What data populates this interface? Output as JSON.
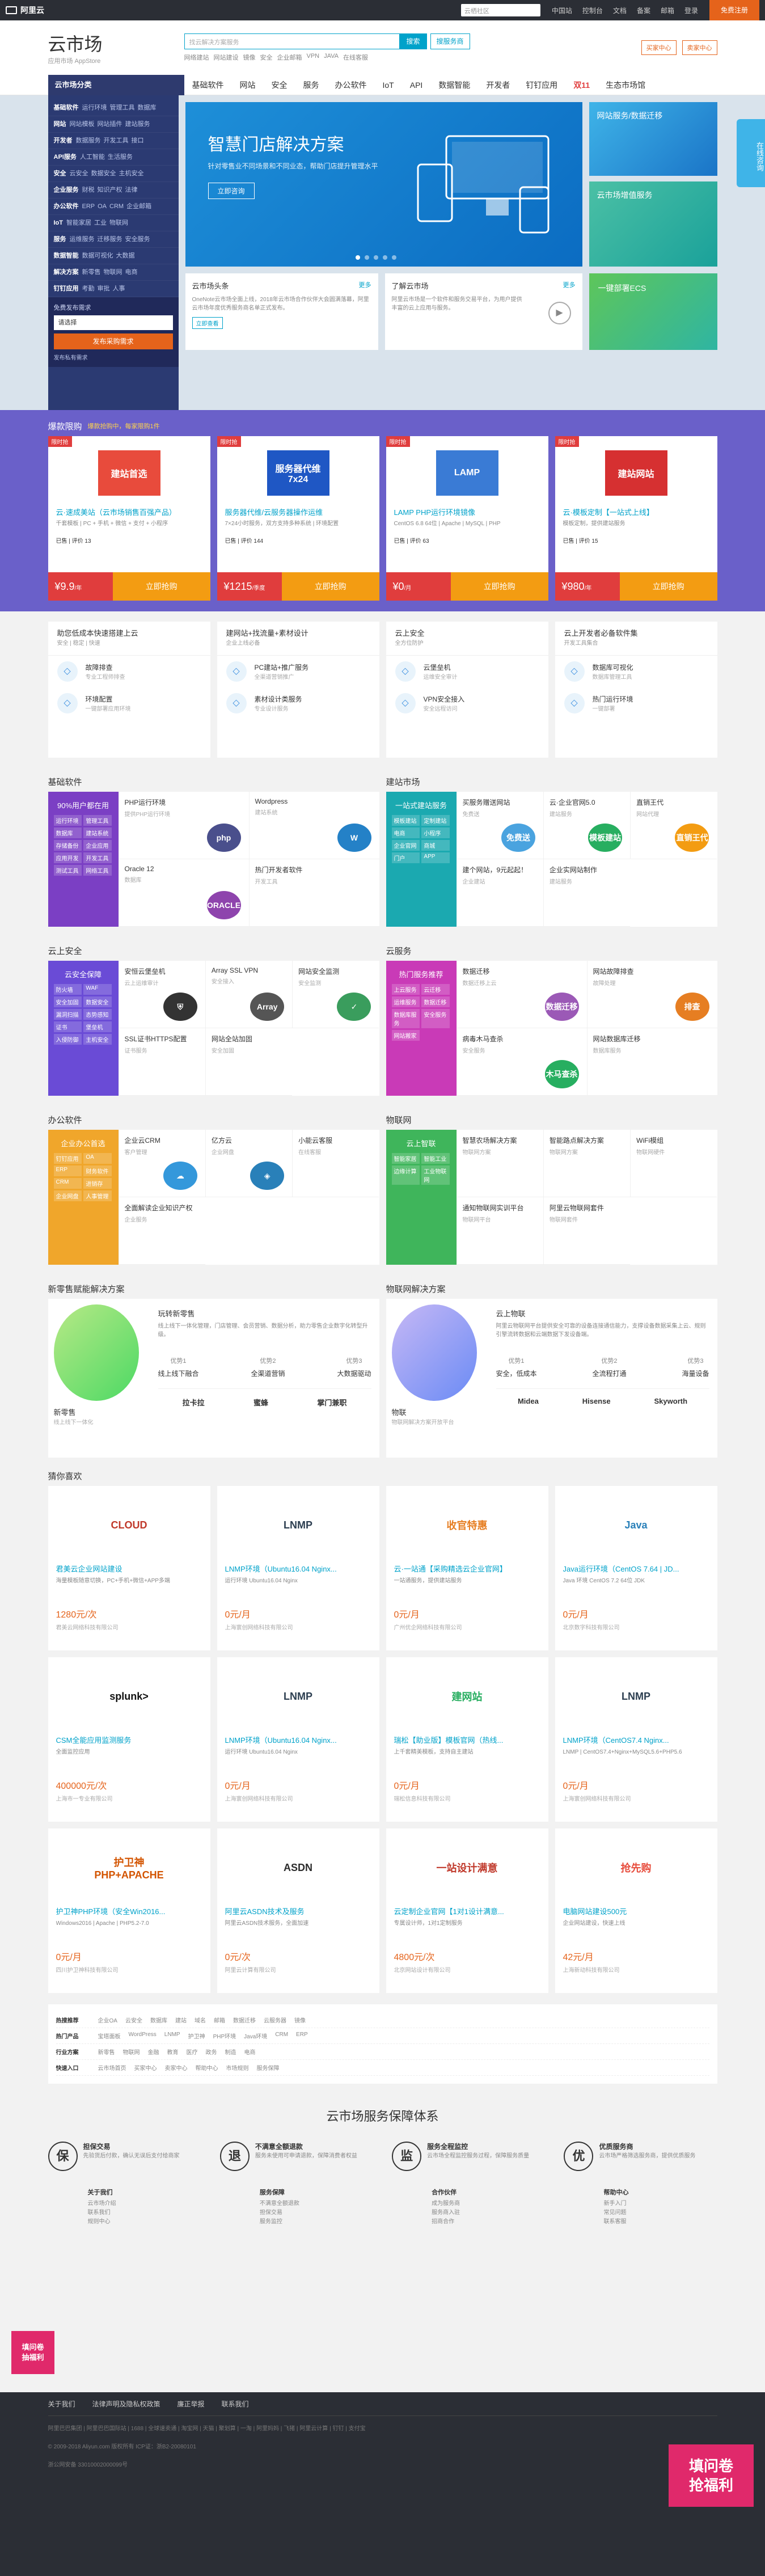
{
  "topbar": {
    "logo": "阿里云",
    "search_placeholder": "云栖社区",
    "links": [
      "中国站",
      "控制台",
      "文档",
      "备案",
      "邮箱",
      "登录"
    ],
    "free_register": "免费注册"
  },
  "header": {
    "title": "云市场",
    "subtitle": "应用市场 AppStore",
    "search_placeholder": "找云解决方案服务",
    "search_btn": "搜索",
    "search_btn2": "搜服务商",
    "hot": [
      "网络建站",
      "网站建设",
      "镜像",
      "安全",
      "企业邮箱",
      "VPN",
      "JAVA",
      "在线客服"
    ],
    "right": [
      "买家中心",
      "卖家中心"
    ]
  },
  "nav": {
    "catalog": "云市场分类",
    "items": [
      "基础软件",
      "网站",
      "安全",
      "服务",
      "办公软件",
      "IoT",
      "API",
      "数据智能",
      "开发者",
      "钉钉应用",
      "双11"
    ],
    "last": "生态市场馆"
  },
  "sidecat": [
    {
      "main": "基础软件",
      "subs": [
        "运行环境",
        "管理工具",
        "数据库"
      ]
    },
    {
      "main": "网站",
      "subs": [
        "网站模板",
        "网站插件",
        "建站服务"
      ]
    },
    {
      "main": "开发者",
      "subs": [
        "数据服务",
        "开发工具",
        "接口"
      ]
    },
    {
      "main": "API服务",
      "subs": [
        "人工智能",
        "生活服务"
      ]
    },
    {
      "main": "安全",
      "subs": [
        "云安全",
        "数据安全",
        "主机安全"
      ]
    },
    {
      "main": "企业服务",
      "subs": [
        "财税",
        "知识产权",
        "法律"
      ]
    },
    {
      "main": "办公软件",
      "subs": [
        "ERP",
        "OA",
        "CRM",
        "企业邮箱"
      ]
    },
    {
      "main": "IoT",
      "subs": [
        "智能家居",
        "工业",
        "物联网"
      ]
    },
    {
      "main": "服务",
      "subs": [
        "运维服务",
        "迁移服务",
        "安全服务"
      ]
    },
    {
      "main": "数据智能",
      "subs": [
        "数据可视化",
        "大数据"
      ]
    },
    {
      "main": "解决方案",
      "subs": [
        "新零售",
        "物联网",
        "电商"
      ]
    },
    {
      "main": "钉钉应用",
      "subs": [
        "考勤",
        "审批",
        "人事"
      ]
    }
  ],
  "login": {
    "title": "免费发布需求",
    "select": "请选择",
    "button": "发布采购需求",
    "mail": "发布私有需求"
  },
  "slide": {
    "title": "智慧门店解决方案",
    "desc": "针对零售业不同场景和不同业态，帮助门店提升管理水平",
    "btn": "立即咨询"
  },
  "side_ads": [
    "网站服务/数据迁移",
    "云市场增值服务",
    "一键部署ECS"
  ],
  "news": {
    "title": "云市场头条",
    "more": "更多",
    "desc": "OneNote云市场全面上线，2018年云市场合作伙伴大会圆满落幕，阿里云市场年度优秀服务商名单正式发布。",
    "btn": "立即查看"
  },
  "about": {
    "title": "了解云市场",
    "desc": "阿里云市场是一个软件和服务交易平台，为用户提供丰富的云上应用与服务。",
    "more": "更多"
  },
  "flash": {
    "title": "爆款限购",
    "sub": "爆款抢购中，每家限购1件"
  },
  "deals": [
    {
      "tag": "限时抢",
      "img": "建站首选",
      "title": "云·速成美站（云市场销售百强产品）",
      "desc": "千套模板 | PC + 手机 + 微信 + 支付 + 小程序",
      "extra": "已售 | 评价 13",
      "price": "9.9",
      "unit": "/年",
      "buy": "立即抢购",
      "color": "#e84b3c"
    },
    {
      "tag": "限时抢",
      "img": "服务器代维7x24",
      "title": "服务器代维/云服务器操作运维",
      "desc": "7×24小时服务，双方支持多种系统 | 环境配置",
      "extra": "已售 | 评价 144",
      "price": "1215",
      "unit": "/季度",
      "buy": "立即抢购",
      "color": "#1f57c4"
    },
    {
      "tag": "限时抢",
      "img": "LAMP",
      "title": "LAMP PHP运行环境镜像",
      "desc": "CentOS 6.8 64位 | Apache | MySQL | PHP",
      "extra": "已售 | 评价 63",
      "price": "0",
      "unit": "/月",
      "buy": "立即抢购",
      "color": "#3a7bd5"
    },
    {
      "tag": "限时抢",
      "img": "建站网站",
      "title": "云·模板定制【一站式上线】",
      "desc": "模板定制，提供建站服务",
      "extra": "已售 | 评价 15",
      "price": "980",
      "unit": "/年",
      "buy": "立即抢购",
      "color": "#d63031"
    }
  ],
  "solutions": [
    {
      "title": "助您低成本快速搭建上云",
      "sub": "安全 | 稳定 | 快速",
      "items": [
        {
          "t": "故障排查",
          "s": "专业工程师排查"
        },
        {
          "t": "环境配置",
          "s": "一键部署应用环境"
        }
      ]
    },
    {
      "title": "建网站+找流量+素材设计",
      "sub": "企业上线必备",
      "items": [
        {
          "t": "PC建站+推广服务",
          "s": "全渠道营销推广"
        },
        {
          "t": "素材设计类服务",
          "s": "专业设计服务"
        }
      ]
    },
    {
      "title": "云上安全",
      "sub": "全方位防护",
      "items": [
        {
          "t": "云堡垒机",
          "s": "运维安全审计"
        },
        {
          "t": "VPN安全接入",
          "s": "安全远程访问"
        }
      ]
    },
    {
      "title": "云上开发者必备软件集",
      "sub": "开发工具集合",
      "items": [
        {
          "t": "数据库可视化",
          "s": "数据库管理工具"
        },
        {
          "t": "热门运行环境",
          "s": "一键部署"
        }
      ]
    }
  ],
  "basic_sw": {
    "title": "基础软件",
    "left_title": "90%用户都在用",
    "tags": [
      "运行环境",
      "管理工具",
      "数据库",
      "建站系统",
      "存储备份",
      "企业应用",
      "应用开发",
      "开发工具",
      "测试工具",
      "网络工具"
    ],
    "cells": [
      {
        "t": "PHP运行环境",
        "s": "提供PHP运行环境",
        "logo": "php",
        "bg": "#4a4f8c"
      },
      {
        "t": "Wordpress",
        "s": "建站系统",
        "logo": "W",
        "bg": "#2481c7"
      },
      {
        "t": "Oracle 12",
        "s": "数据库",
        "logo": "ORACLE",
        "bg": "#8e44ad"
      },
      {
        "t": "热门开发者软件",
        "s": "开发工具",
        "logo": "",
        "bg": "#fff"
      }
    ]
  },
  "website": {
    "title": "建站市场",
    "left_title": "一站式建站服务",
    "tags": [
      "模板建站",
      "定制建站",
      "电商",
      "小程序",
      "企业官网",
      "商城",
      "门户",
      "APP"
    ],
    "cells": [
      {
        "t": "买服务赠送网站",
        "s": "免费送",
        "logo": "免费送",
        "bg": "#4aa3df"
      },
      {
        "t": "云·企业官网5.0",
        "s": "建站服务",
        "logo": "模板建站",
        "bg": "#27ae60"
      },
      {
        "t": "直销王代",
        "s": "网站代理",
        "logo": "直销王代",
        "bg": "#f39c12"
      },
      {
        "t": "建个网站，9元起起！",
        "s": "企业建站",
        "logo": "",
        "bg": "#fff"
      },
      {
        "t": "企业实网站制作",
        "s": "建站服务",
        "logo": "",
        "bg": "#fff"
      }
    ]
  },
  "cloud_sec": {
    "title": "云上安全",
    "left_title": "云安全保障",
    "tags": [
      "防火墙",
      "WAF",
      "安全加固",
      "数据安全",
      "漏洞扫描",
      "态势感知",
      "证书",
      "堡垒机",
      "入侵防御",
      "主机安全"
    ],
    "cells": [
      {
        "t": "安恒云堡垒机",
        "s": "云上运维审计",
        "logo": "⛨",
        "bg": "#333"
      },
      {
        "t": "Array SSL VPN",
        "s": "安全接入",
        "logo": "Array",
        "bg": "#555"
      },
      {
        "t": "网站安全监测",
        "s": "安全监测",
        "logo": "✓",
        "bg": "#3a9d5d"
      },
      {
        "t": "SSL证书HTTPS配置",
        "s": "证书服务",
        "logo": "",
        "bg": "#fff"
      },
      {
        "t": "网站全站加固",
        "s": "安全加固",
        "logo": "",
        "bg": "#fff"
      }
    ]
  },
  "cloud_svc": {
    "title": "云服务",
    "left_title": "热门服务推荐",
    "tags": [
      "上云服务",
      "云迁移",
      "运维服务",
      "数据迁移",
      "数据库服务",
      "安全服务",
      "网站搬家"
    ],
    "cells": [
      {
        "t": "数据迁移",
        "s": "数据迁移上云",
        "logo": "数据迁移",
        "bg": "#9b59b6"
      },
      {
        "t": "网站故障排查",
        "s": "故障处理",
        "logo": "排查",
        "bg": "#e67e22"
      },
      {
        "t": "病毒木马查杀",
        "s": "安全服务",
        "logo": "木马查杀",
        "bg": "#27ae60"
      },
      {
        "t": "网站数据库迁移",
        "s": "数据库服务",
        "logo": "",
        "bg": "#fff"
      }
    ]
  },
  "office": {
    "title": "办公软件",
    "left_title": "企业办公首选",
    "tags": [
      "钉钉应用",
      "OA",
      "ERP",
      "财务软件",
      "CRM",
      "进销存",
      "企业网盘",
      "人事管理"
    ],
    "cells": [
      {
        "t": "企业云CRM",
        "s": "客户管理",
        "logo": "☁",
        "bg": "#3498db"
      },
      {
        "t": "亿方云",
        "s": "企业网盘",
        "logo": "◈",
        "bg": "#2980b9"
      },
      {
        "t": "小能云客服",
        "s": "在线客服",
        "logo": "",
        "bg": "#fff"
      },
      {
        "t": "全面解读企业知识产权",
        "s": "企业服务",
        "logo": "",
        "bg": "#fff"
      }
    ]
  },
  "iot": {
    "title": "物联网",
    "left_title": "云上智联",
    "tags": [
      "智能家居",
      "智能工业",
      "边缘计算",
      "工业物联网"
    ],
    "cells": [
      {
        "t": "智慧农场解决方案",
        "s": "物联网方案",
        "logo": "",
        "bg": "#fff"
      },
      {
        "t": "智能路点解决方案",
        "s": "物联网方案",
        "logo": "",
        "bg": "#fff"
      },
      {
        "t": "WiFi模组",
        "s": "物联网硬件",
        "logo": "",
        "bg": "#fff"
      },
      {
        "t": "通知物联网实训平台",
        "s": "物联网平台",
        "logo": "",
        "bg": "#fff"
      },
      {
        "t": "阿里云物联网套件",
        "s": "物联网套件",
        "logo": "",
        "bg": "#fff"
      }
    ]
  },
  "retail": {
    "title": "新零售赋能解决方案",
    "name": "新零售",
    "nav": "线上线下一体化",
    "heading": "玩转新零售",
    "desc": "线上线下一体化管理，门店管理、会员营销、数据分析，助力零售企业数字化转型升级。",
    "cols": [
      {
        "a": "优势1",
        "b": "线上线下融合"
      },
      {
        "a": "优势2",
        "b": "全渠道营销"
      },
      {
        "a": "优势3",
        "b": "大数据驱动"
      }
    ],
    "brands": [
      "拉卡拉",
      "蜜蜂",
      "掌门兼职"
    ]
  },
  "iot_sol": {
    "title": "物联网解决方案",
    "name": "物联",
    "nav": "物联网解决方案开放平台",
    "heading": "云上物联",
    "desc": "阿里云物联网平台提供安全可靠的设备连接通信能力，支撑设备数据采集上云、规则引擎流转数据和云端数据下发设备端。",
    "cols": [
      {
        "a": "优势1",
        "b": "安全，低成本"
      },
      {
        "a": "优势2",
        "b": "全流程打通"
      },
      {
        "a": "优势3",
        "b": "海量设备"
      }
    ],
    "brands": [
      "Midea",
      "Hisense",
      "Skyworth"
    ]
  },
  "guess": {
    "title": "猜你喜欢",
    "cards": [
      {
        "img": "CLOUD",
        "title": "君美云企业网站建设",
        "desc": "海量模板随意切换，PC+手机+微信+APP多端",
        "price": "1280元/次",
        "vendor": "君美云网络科技有限公司",
        "c": "#c0392b"
      },
      {
        "img": "LNMP",
        "title": "LNMP环境（Ubuntu16.04 Nginx...",
        "desc": "运行环境 Ubuntu16.04 Nginx",
        "price": "0元/月",
        "vendor": "上海寰创网络科技有限公司",
        "c": "#2c3e50"
      },
      {
        "img": "收官特惠",
        "title": "云·一站通【采购精选云企业官网】",
        "desc": "一站通服务，提供建站服务",
        "price": "0元/月",
        "vendor": "广州优企网络科技有限公司",
        "c": "#e67e22"
      },
      {
        "img": "Java",
        "title": "Java运行环境（CentOS 7.64 | JD...",
        "desc": "Java 环境 CentOS 7.2 64位 JDK",
        "price": "0元/月",
        "vendor": "北京数字科技有限公司",
        "c": "#2980b9"
      },
      {
        "img": "splunk>",
        "title": "CSM全能应用监测服务",
        "desc": "全面监控应用",
        "price": "400000元/次",
        "vendor": "上海市一专业有限公司",
        "c": "#111"
      },
      {
        "img": "LNMP",
        "title": "LNMP环境（Ubuntu16.04 Nginx...",
        "desc": "运行环境 Ubuntu16.04 Nginx",
        "price": "0元/月",
        "vendor": "上海寰创网络科技有限公司",
        "c": "#2c3e50"
      },
      {
        "img": "建网站",
        "title": "瑞松【助业版】模板官网（热线...",
        "desc": "上千套精美模板，支持自主建站",
        "price": "0元/月",
        "vendor": "瑞松信息科技有限公司",
        "c": "#27ae60"
      },
      {
        "img": "LNMP",
        "title": "LNMP环境（CentOS7.4 Nginx...",
        "desc": "LNMP | CentOS7.4+Nginx+MySQL5.6+PHP5.6",
        "price": "0元/月",
        "vendor": "上海寰创网络科技有限公司",
        "c": "#2c3e50"
      },
      {
        "img": "护卫神 PHP+APACHE",
        "title": "护卫神PHP环境（安全Win2016...",
        "desc": "Windows2016 | Apache | PHP5.2-7.0",
        "price": "0元/月",
        "vendor": "四川护卫神科技有限公司",
        "c": "#d35400"
      },
      {
        "img": "ASDN",
        "title": "阿里云ASDN技术及服务",
        "desc": "阿里云ASDN技术服务，全面加速",
        "price": "0元/次",
        "vendor": "阿里云计算有限公司",
        "c": "#2c2c2c"
      },
      {
        "img": "一站设计满意",
        "title": "云定制企业官网【1对1设计满意...",
        "desc": "专属设计师，1对1定制服务",
        "price": "4800元/次",
        "vendor": "北京网站设计有限公司",
        "c": "#c0392b"
      },
      {
        "img": "抢先购",
        "title": "电脑网站建设500元",
        "desc": "企业网站建设，快速上线",
        "price": "42元/月",
        "vendor": "上海新动科技有限公司",
        "c": "#e74c3c"
      }
    ]
  },
  "hotlinks": [
    {
      "k": "热搜推荐",
      "v": [
        "企业OA",
        "云安全",
        "数据库",
        "建站",
        "域名",
        "邮箱",
        "数据迁移",
        "云服务器",
        "镜像"
      ]
    },
    {
      "k": "热门产品",
      "v": [
        "宝塔面板",
        "WordPress",
        "LNMP",
        "护卫神",
        "PHP环境",
        "Java环境",
        "CRM",
        "ERP"
      ]
    },
    {
      "k": "行业方案",
      "v": [
        "新零售",
        "物联网",
        "金融",
        "教育",
        "医疗",
        "政务",
        "制造",
        "电商"
      ]
    },
    {
      "k": "快速入口",
      "v": [
        "云市场首页",
        "买家中心",
        "卖家中心",
        "帮助中心",
        "市场规则",
        "服务保障"
      ]
    }
  ],
  "assurance": {
    "title": "云市场服务保障体系",
    "items": [
      {
        "icon": "保",
        "t": "担保交易",
        "s": "先验货后付款，确认无误后支付给商家"
      },
      {
        "icon": "退",
        "t": "不满意全额退款",
        "s": "服务未使用可申请退款，保障消费者权益"
      },
      {
        "icon": "监",
        "t": "服务全程监控",
        "s": "云市场全程监控服务过程，保障服务质量"
      },
      {
        "icon": "优",
        "t": "优质服务商",
        "s": "云市场严格筛选服务商，提供优质服务"
      }
    ]
  },
  "flinks": [
    {
      "t": "关于我们",
      "v": [
        "云市场介绍",
        "联系我们",
        "规则中心"
      ]
    },
    {
      "t": "服务保障",
      "v": [
        "不满意全额退款",
        "担保交易",
        "服务监控"
      ]
    },
    {
      "t": "合作伙伴",
      "v": [
        "成为服务商",
        "服务商入驻",
        "招商合作"
      ]
    },
    {
      "t": "帮助中心",
      "v": [
        "新手入门",
        "常见问题",
        "联系客服"
      ]
    }
  ],
  "footer": {
    "links": [
      "关于我们",
      "法律声明及隐私权政策",
      "廉正举报",
      "联系我们"
    ],
    "p1": "阿里巴巴集团 | 阿里巴巴国际站 | 1688 | 全球速卖通 | 淘宝网 | 天猫 | 聚划算 | 一淘 | 阿里妈妈 | 飞猪 | 阿里云计算 | 钉钉 | 支付宝",
    "p2": "© 2009-2018 Aliyun.com 版权所有 ICP证：浙B2-20080101",
    "p3": "浙公网安备 33010002000099号"
  },
  "float": {
    "right": "在线咨询",
    "left": "填问卷\n抽福利",
    "br": "填问卷\n抢福利"
  }
}
